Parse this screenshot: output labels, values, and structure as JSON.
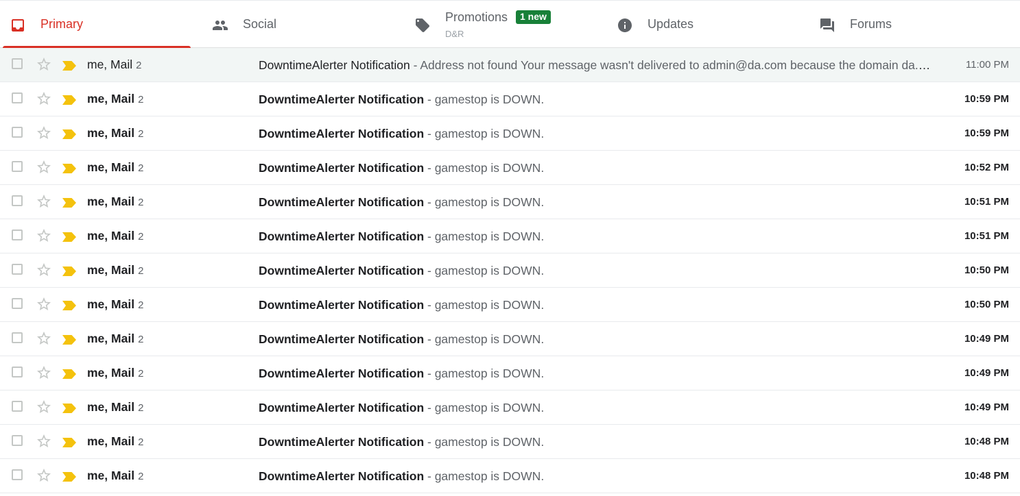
{
  "tabs": [
    {
      "label": "Primary",
      "icon": "inbox-icon",
      "selected": true
    },
    {
      "label": "Social",
      "icon": "people-icon",
      "selected": false
    },
    {
      "label": "Promotions",
      "icon": "tag-icon",
      "selected": false,
      "badge": "1 new",
      "snippet": "D&R"
    },
    {
      "label": "Updates",
      "icon": "info-icon",
      "selected": false
    },
    {
      "label": "Forums",
      "icon": "forum-icon",
      "selected": false
    }
  ],
  "colors": {
    "primary_accent": "#d93025",
    "badge_bg": "#188038",
    "important_marker": "#f4c20d",
    "read_row_bg": "#f2f6f5"
  },
  "emails": [
    {
      "sender_names": "me, Mail",
      "count": "2",
      "subject": "DowntimeAlerter Notification",
      "snippet": " - Address not found Your message wasn't delivered to admin@da.com because the domain da.com couldn't be found.",
      "time": "11:00 PM",
      "unread": false
    },
    {
      "sender_names": "me, Mail",
      "count": "2",
      "subject": "DowntimeAlerter Notification",
      "snippet": " - gamestop is DOWN.",
      "time": "10:59 PM",
      "unread": true
    },
    {
      "sender_names": "me, Mail",
      "count": "2",
      "subject": "DowntimeAlerter Notification",
      "snippet": " - gamestop is DOWN.",
      "time": "10:59 PM",
      "unread": true
    },
    {
      "sender_names": "me, Mail",
      "count": "2",
      "subject": "DowntimeAlerter Notification",
      "snippet": " - gamestop is DOWN.",
      "time": "10:52 PM",
      "unread": true
    },
    {
      "sender_names": "me, Mail",
      "count": "2",
      "subject": "DowntimeAlerter Notification",
      "snippet": " - gamestop is DOWN.",
      "time": "10:51 PM",
      "unread": true
    },
    {
      "sender_names": "me, Mail",
      "count": "2",
      "subject": "DowntimeAlerter Notification",
      "snippet": " - gamestop is DOWN.",
      "time": "10:51 PM",
      "unread": true
    },
    {
      "sender_names": "me, Mail",
      "count": "2",
      "subject": "DowntimeAlerter Notification",
      "snippet": " - gamestop is DOWN.",
      "time": "10:50 PM",
      "unread": true
    },
    {
      "sender_names": "me, Mail",
      "count": "2",
      "subject": "DowntimeAlerter Notification",
      "snippet": " - gamestop is DOWN.",
      "time": "10:50 PM",
      "unread": true
    },
    {
      "sender_names": "me, Mail",
      "count": "2",
      "subject": "DowntimeAlerter Notification",
      "snippet": " - gamestop is DOWN.",
      "time": "10:49 PM",
      "unread": true
    },
    {
      "sender_names": "me, Mail",
      "count": "2",
      "subject": "DowntimeAlerter Notification",
      "snippet": " - gamestop is DOWN.",
      "time": "10:49 PM",
      "unread": true
    },
    {
      "sender_names": "me, Mail",
      "count": "2",
      "subject": "DowntimeAlerter Notification",
      "snippet": " - gamestop is DOWN.",
      "time": "10:49 PM",
      "unread": true
    },
    {
      "sender_names": "me, Mail",
      "count": "2",
      "subject": "DowntimeAlerter Notification",
      "snippet": " - gamestop is DOWN.",
      "time": "10:48 PM",
      "unread": true
    },
    {
      "sender_names": "me, Mail",
      "count": "2",
      "subject": "DowntimeAlerter Notification",
      "snippet": " - gamestop is DOWN.",
      "time": "10:48 PM",
      "unread": true
    }
  ]
}
